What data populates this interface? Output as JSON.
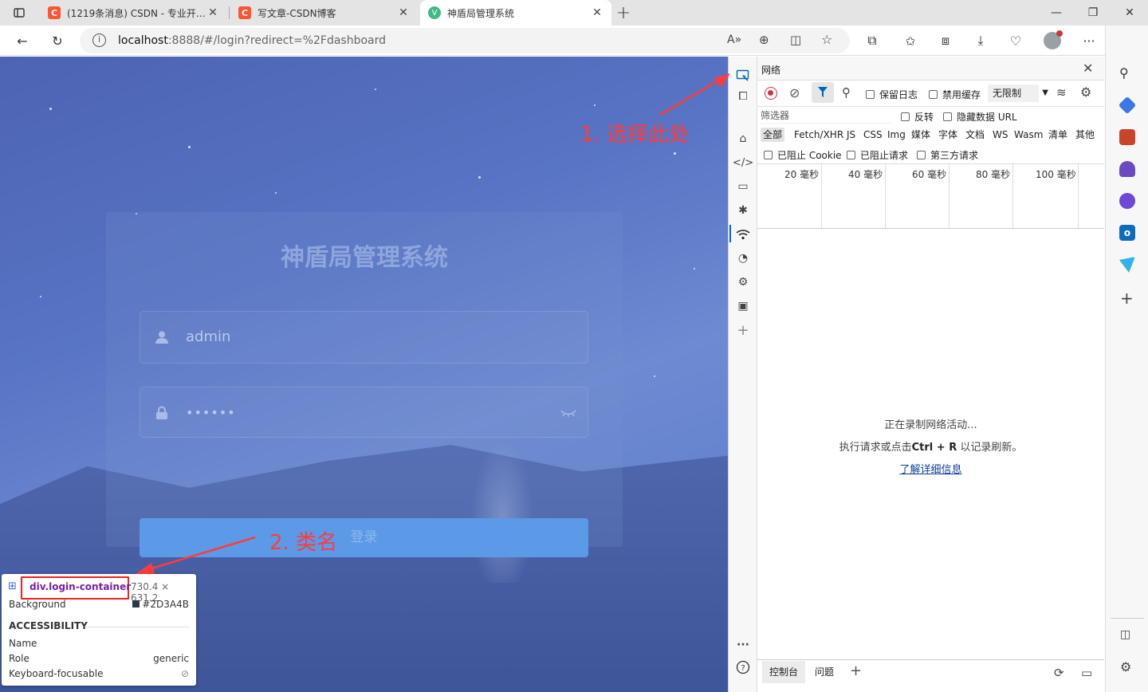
{
  "browser": {
    "tabs": [
      {
        "title": "(1219条消息) CSDN - 专业开发者...",
        "favicon": "C"
      },
      {
        "title": "写文章-CSDN博客",
        "favicon": "C"
      },
      {
        "title": "神盾局管理系统",
        "favicon": "V"
      }
    ],
    "new_tab": "+",
    "url_host": "localhost",
    "url_rest": ":8888/#/login?redirect=%2Fdashboard"
  },
  "login": {
    "title": "神盾局管理系统",
    "username": "admin",
    "password_mask": "••••••",
    "submit_label": "登录"
  },
  "tooltip": {
    "selector": "div.login-container",
    "size": "730.4 × 631.2",
    "background_label": "Background",
    "background_value": "#2D3A4B",
    "accessibility_heading": "ACCESSIBILITY",
    "name_label": "Name",
    "name_value": "",
    "role_label": "Role",
    "role_value": "generic",
    "focus_label": "Keyboard-focusable"
  },
  "annotations": {
    "step1": "1. 选择此处",
    "step2": "2. 类名"
  },
  "devtools": {
    "panel_title": "网络",
    "preserve_log": "保留日志",
    "disable_cache": "禁用缓存",
    "throttle": "无限制",
    "filter_placeholder": "筛选器",
    "invert": "反转",
    "hide_data_urls": "隐藏数据 URL",
    "type_filters": [
      "全部",
      "Fetch/XHR",
      "JS",
      "CSS",
      "Img",
      "媒体",
      "字体",
      "文档",
      "WS",
      "Wasm",
      "清单",
      "其他"
    ],
    "blocked_cookies": "已阻止 Cookie",
    "blocked_requests": "已阻止请求",
    "third_party": "第三方请求",
    "timeline_ticks": [
      "20 毫秒",
      "40 毫秒",
      "60 毫秒",
      "80 毫秒",
      "100 毫秒"
    ],
    "recording_msg": "正在录制网络活动...",
    "hint_prefix": "执行请求或点击",
    "hint_key": "Ctrl + R",
    "hint_suffix": "以记录刷新。",
    "learn_more": "了解详细信息",
    "drawer_tabs": [
      "控制台",
      "问题"
    ]
  },
  "colors": {
    "accent": "#0067c0",
    "annotation": "#ff3b3b",
    "csdn": "#fc5531",
    "vue": "#42b883",
    "login_button": "#5c99e6"
  }
}
